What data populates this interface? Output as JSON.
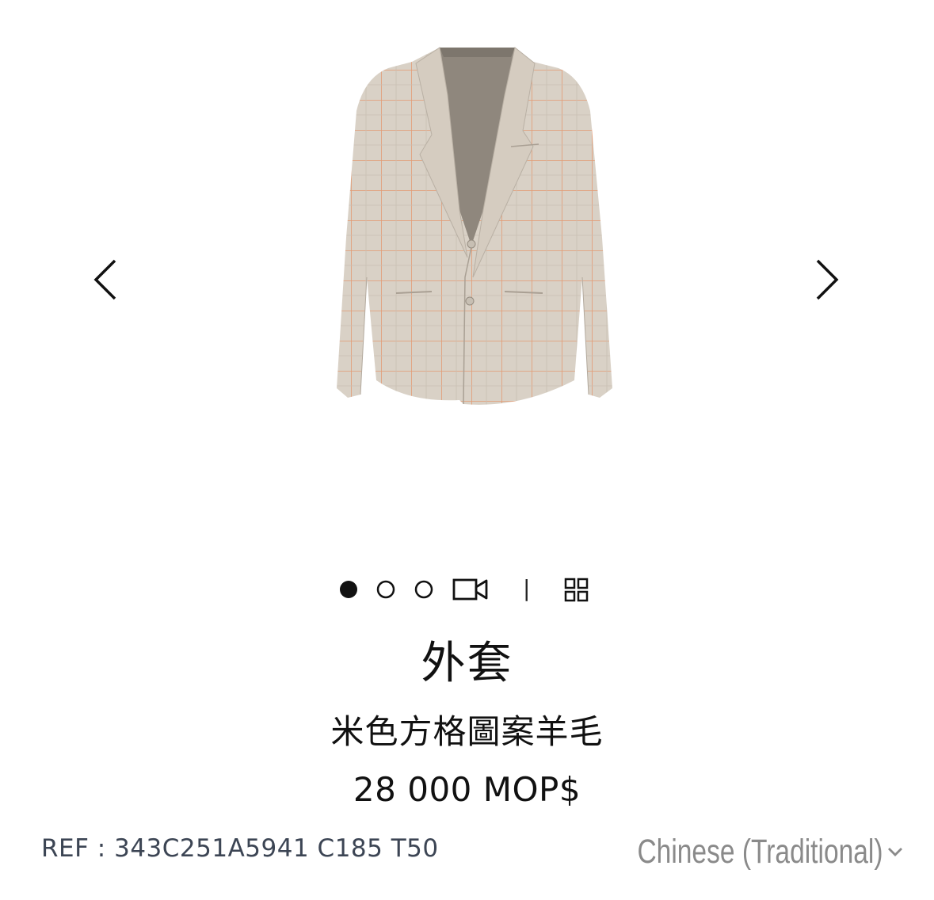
{
  "product": {
    "title": "外套",
    "subtitle": "米色方格圖案羊毛",
    "price": "28 000 MOP$",
    "ref": "REF : 343C251A5941 C185 T50"
  },
  "gallery": {
    "image_icon": "checked-wool-blazer-image",
    "prev_icon": "chevron-left-icon",
    "next_icon": "chevron-right-icon",
    "slide_count": 3,
    "active_slide": 1
  },
  "indicators": {
    "separator": "|",
    "video_icon": "video-camera-icon",
    "grid_icon": "grid-view-icon"
  },
  "language": {
    "selected": "Chinese (Traditional)",
    "icon": "chevron-down-icon"
  },
  "colors": {
    "text": "#111111",
    "ref_text": "#3c4554",
    "lang_text": "#8a8a8a",
    "blazer": "#d9d0c4",
    "check_line": "#e0936c"
  }
}
